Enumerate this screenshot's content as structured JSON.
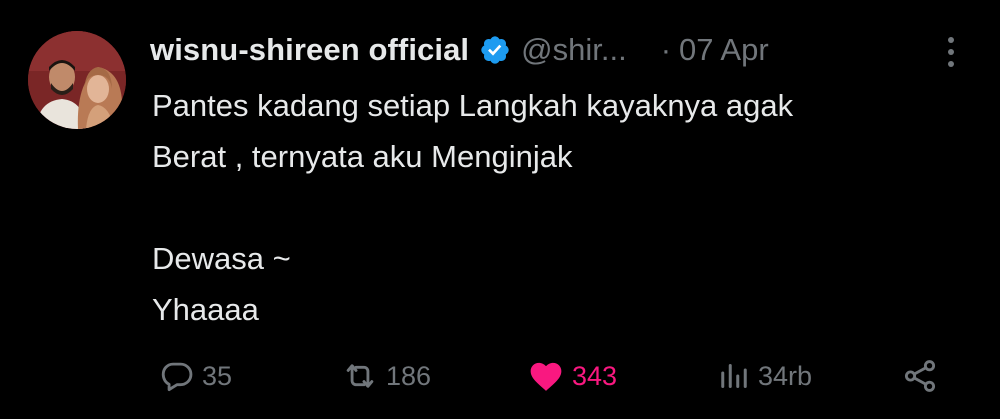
{
  "tweet": {
    "display_name": "wisnu-shireen official",
    "handle": "@shir...",
    "separator": "·",
    "date": "07 Apr",
    "verified": true,
    "text": "Pantes kadang setiap Langkah kayaknya agak\nBerat , ternyata aku Menginjak\n\nDewasa ~\nYhaaaa"
  },
  "actions": {
    "replies": "35",
    "retweets": "186",
    "likes": "343",
    "views": "34rb"
  },
  "icons": {
    "verified": "verified-badge-icon",
    "more": "more-vertical-icon",
    "reply": "reply-icon",
    "retweet": "retweet-icon",
    "like": "heart-icon",
    "views": "views-chart-icon",
    "share": "share-icon"
  },
  "colors": {
    "background": "#000000",
    "text": "#e7e9ea",
    "muted": "#71767b",
    "verified": "#1d9bf0",
    "like": "#f91880"
  }
}
